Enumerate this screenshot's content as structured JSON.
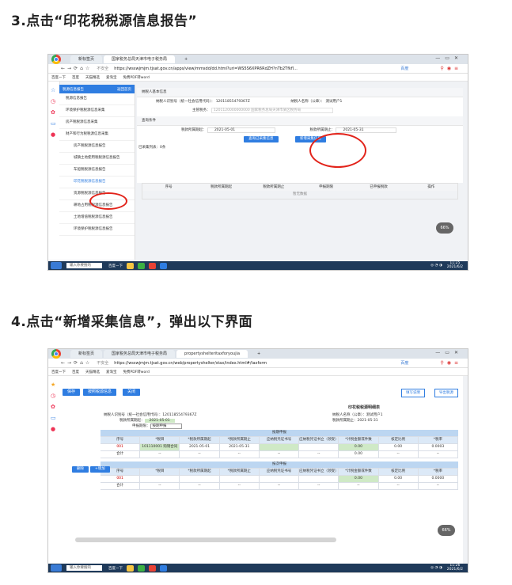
{
  "steps": [
    {
      "title": "3.点击“印花税税源信息报告”"
    },
    {
      "title": "4.点击“新增采集信息”，弹出以下界面"
    }
  ],
  "shot1": {
    "tabs": [
      "新标签页",
      "国家税务总局天津市电子税务局",
      "+"
    ],
    "address": "https://wsswjmjm.tjsat.gov.cn/apps/view/mmsdd/dd.html?uri=WS5S6XPR6RdZH?nTb2Tfkfl...",
    "address_prefix": "不安全",
    "search_box": "百度",
    "bookmarks": [
      "百度一下",
      "百度",
      "天猫精选",
      "爱淘宝",
      "免费PDF转word"
    ],
    "sidebar": {
      "title": "税源信息报告",
      "collapse": "返回首页",
      "items": [
        {
          "label": "税源信息报告",
          "level": 1
        },
        {
          "label": "环境保护税税源信息采集",
          "level": 2
        },
        {
          "label": "房产税税源信息采集",
          "level": 2
        },
        {
          "label": "财产和行为税税源信息采集",
          "level": 2
        },
        {
          "label": "房产税税源信息报告",
          "level": 3
        },
        {
          "label": "城镇土地使用税税源信息报告",
          "level": 3
        },
        {
          "label": "车船税税源信息报告",
          "level": 3
        },
        {
          "label": "印花税税源信息报告",
          "level": 3
        },
        {
          "label": "资源税税源信息报告",
          "level": 3
        },
        {
          "label": "耕地占用税税源信息报告",
          "level": 3
        },
        {
          "label": "土地增值税税源信息报告",
          "level": 3
        },
        {
          "label": "环境保护税税源信息报告",
          "level": 3
        }
      ]
    },
    "basic_info": {
      "section": "纳税人基本信息",
      "id_label": "纳税人识别号（统一社会信用代码）：",
      "id_value": "12011855479367Z",
      "name_label": "纳税人名称（公章）：",
      "name_value": "测试用户1",
      "code_label": "主管税务：",
      "code_value": "1201120000000000 国家税务总局天津市某区税务局"
    },
    "query": {
      "section": "查询条件",
      "start_label": "税款所属期起：",
      "start_value": "2021-05-01",
      "end_label": "税款所属期止：",
      "end_value": "2021-05-31",
      "btn_query": "查询已采集信息",
      "btn_add": "新增采集信息"
    },
    "results": {
      "summary": "已采集列表：0条",
      "columns": [
        "序号",
        "税款所属期起",
        "税款所属期止",
        "申报期限",
        "已申报税款",
        "操作"
      ],
      "empty": "暂无数据"
    },
    "float": "66%",
    "taskbar": {
      "search": "输入你要搜的",
      "time": "11:25",
      "date": "2021/6/2",
      "tab_label": "百度一下"
    }
  },
  "shot2": {
    "tabs": [
      "新标签页",
      "国家税务总局天津市电子税务局",
      "propertyshelteritaxforyoujia",
      "+"
    ],
    "address": "https://wsswjmjm.tjsat.gov.cn/web/propertyshelter/stax/index.html#/taxform",
    "address_prefix": "不安全",
    "search_box": "百度",
    "bookmarks": [
      "百度一下",
      "百度",
      "天猫精选",
      "爱淘宝",
      "免费PDF转word"
    ],
    "buttons": {
      "save": "保存",
      "import": "按照税源信息",
      "close": "关闭"
    },
    "top_right": [
      "填写说明",
      "导出税源"
    ],
    "form_title": "印花税税源明细表",
    "header_left": {
      "id_label": "纳税人识别号（统一社会信用代码）：",
      "id_value": "12011855479367Z",
      "start_label": "税款所属期起：",
      "start_value": "2021-05-01",
      "method_label": "申报期限：",
      "method_value": "按期申报"
    },
    "header_right": {
      "name_label": "纳税人名称（公章）：",
      "name_value": "测试用户1",
      "end_label": "税款所属期止：",
      "end_value": "2021-05-31"
    },
    "band1": "按期申报",
    "band2": "按次申报",
    "columns": [
      "序号",
      "*税目",
      "*税款所属期起",
      "*税款所属期止",
      "应纳税凭证书号",
      "应纳税凭证书立（领受）日期",
      "*计税金额或件数",
      "核定比例",
      "*税率"
    ],
    "row1": [
      "001",
      "101110001 购销合同",
      "2021-05-01",
      "2021-05-31",
      "",
      "",
      "0.00",
      "0.00",
      "0.0003"
    ],
    "sum_row": [
      "合计",
      "--",
      "--",
      "--",
      "--",
      "--",
      "0.00",
      "--",
      "--"
    ],
    "row2": [
      "001",
      "",
      "",
      "",
      "",
      "",
      "0.00",
      "0.00",
      "0.0000"
    ],
    "sum_row2": [
      "合计",
      "--",
      "--",
      "--",
      "--",
      "--",
      "--",
      "--",
      "--"
    ],
    "row_btns": [
      "删除",
      "+增加"
    ],
    "float": "66%",
    "taskbar": {
      "search": "输入你要搜的",
      "time": "11:26",
      "date": "2021/6/2",
      "tab_label": "百度一下"
    }
  },
  "colors": {
    "accent": "#2f7de1",
    "highlight": "#e2231a",
    "taskbar": "#1f3a5a"
  },
  "icons": [
    "browser-logo-icon",
    "star-icon",
    "clock-icon",
    "gear-icon",
    "doc-icon",
    "close-icon",
    "minimize-icon",
    "maximize-icon"
  ]
}
